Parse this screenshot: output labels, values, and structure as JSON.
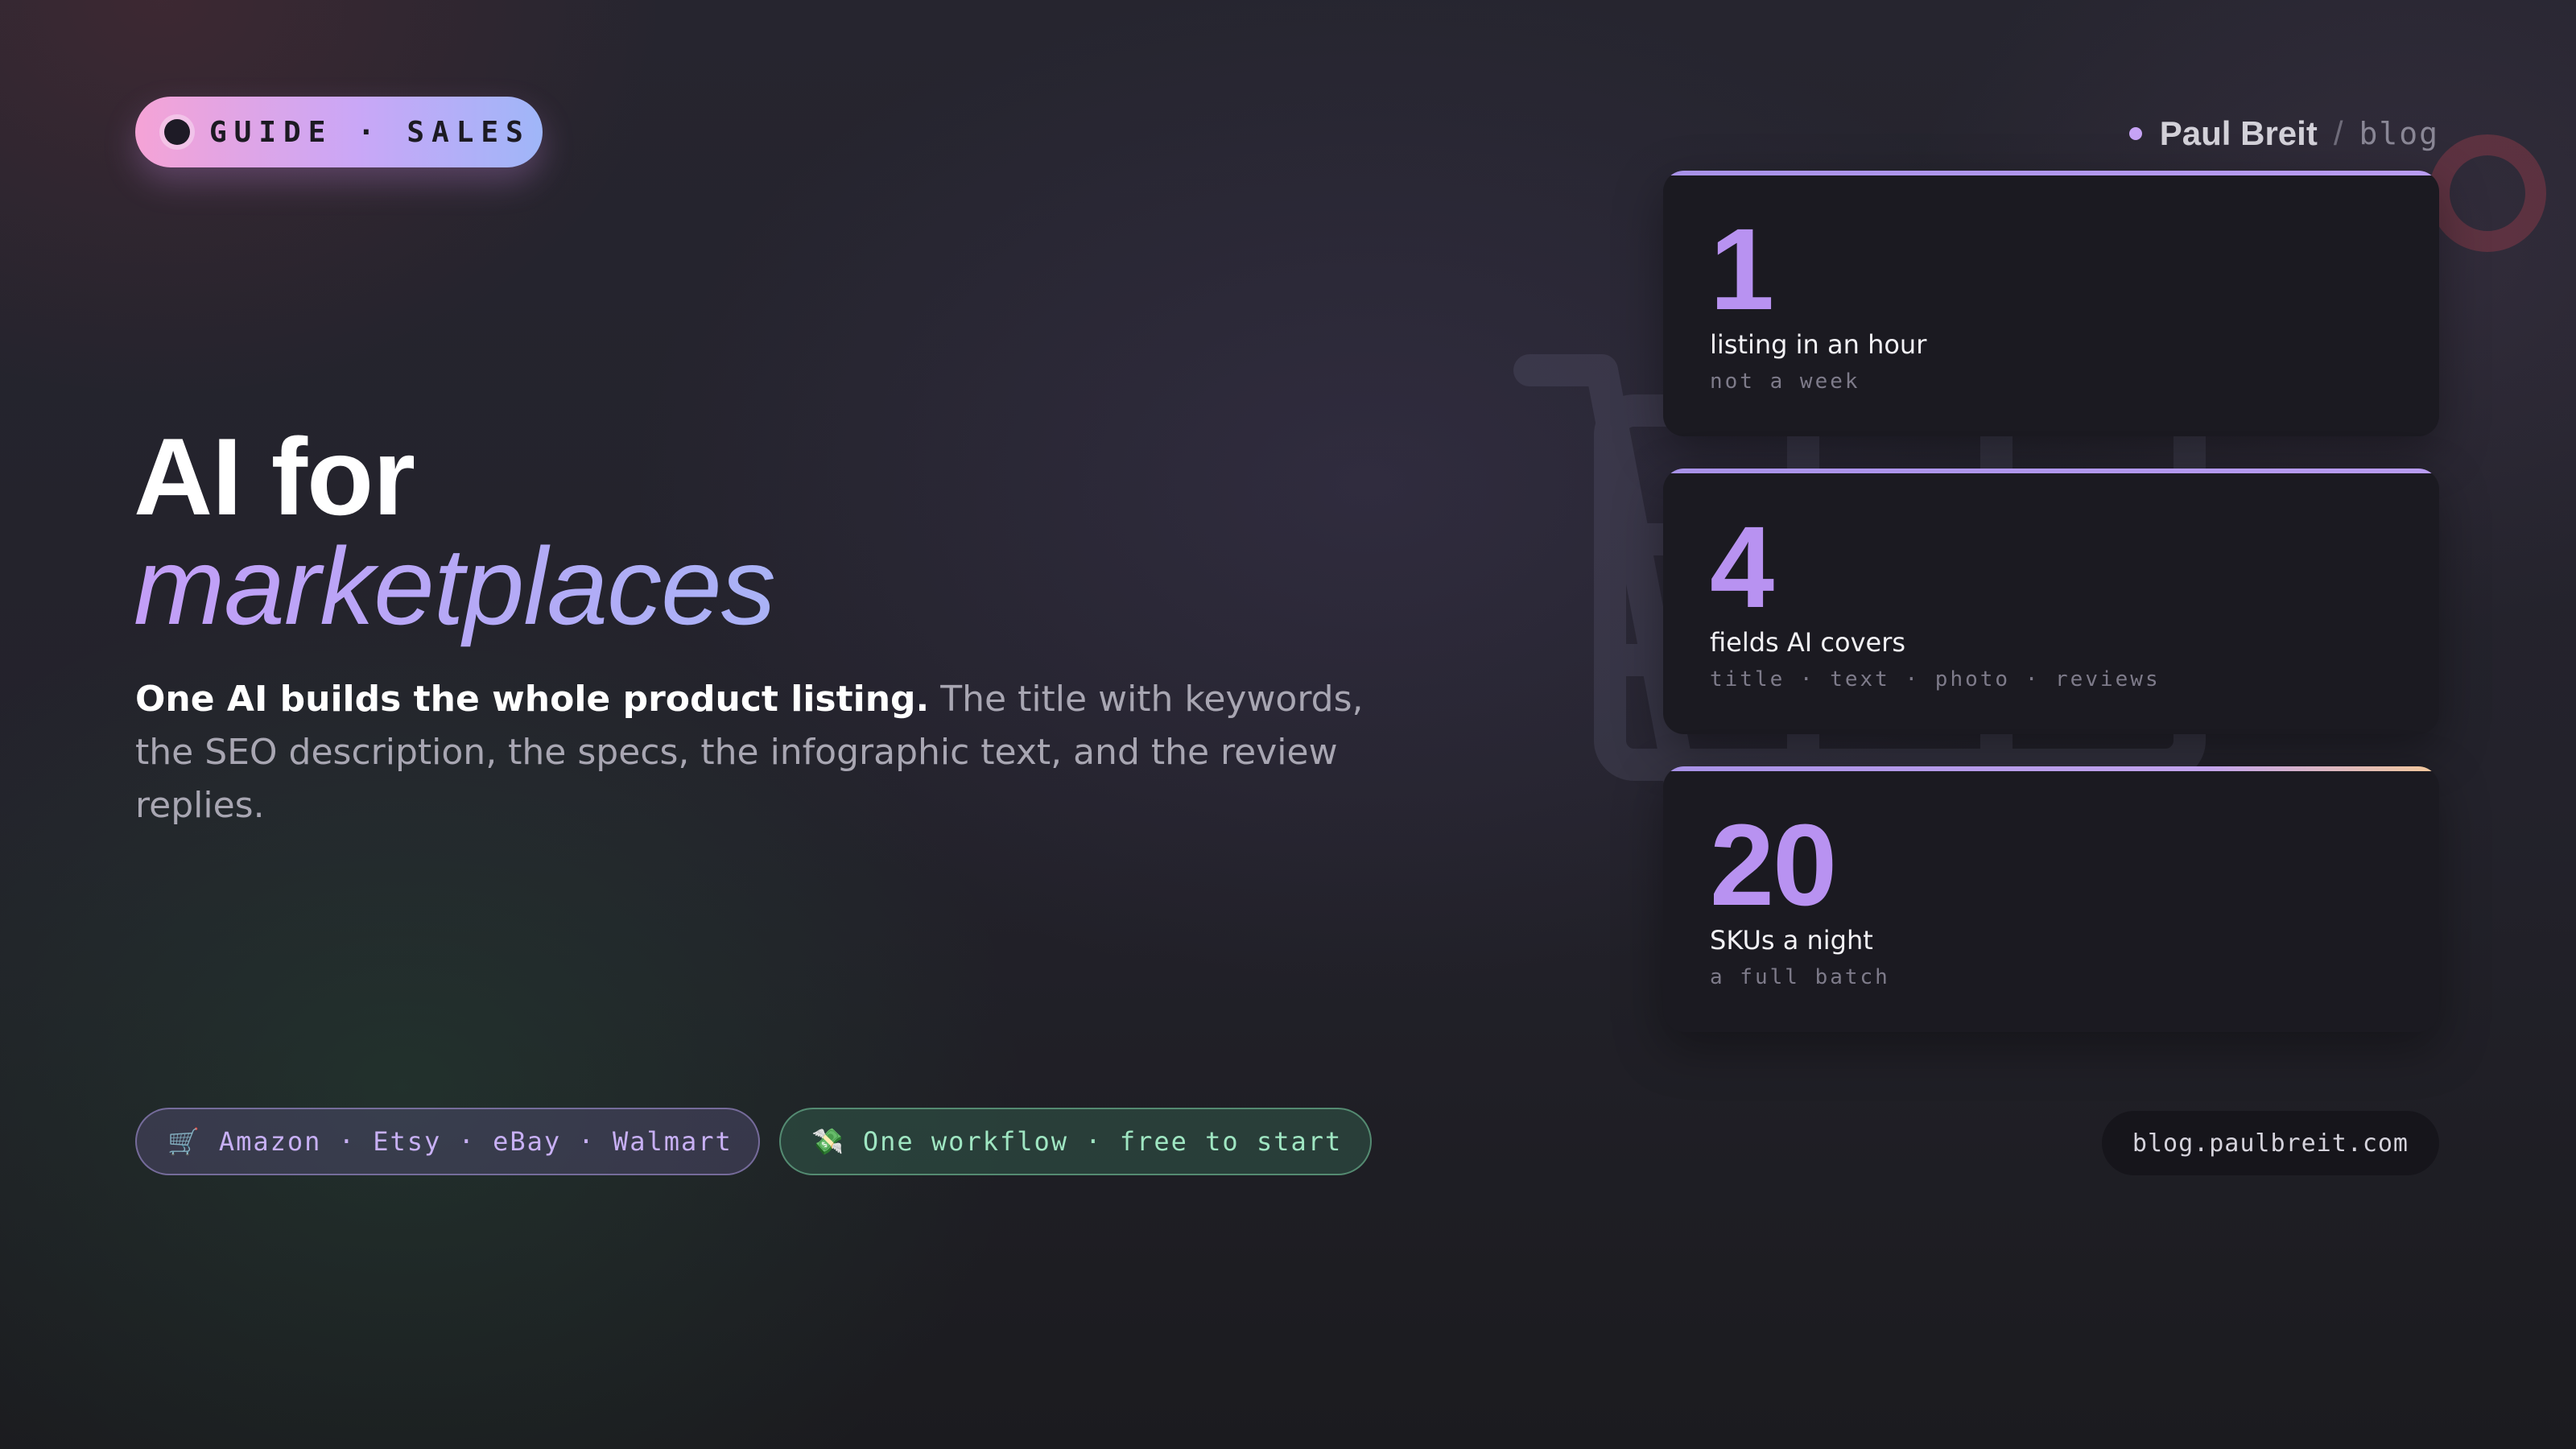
{
  "badge": {
    "text": "GUIDE · SALES"
  },
  "author": {
    "name": "Paul Breit",
    "separator": "/",
    "section": "blog"
  },
  "headline": {
    "line1": "AI for",
    "line2": "marketplaces"
  },
  "lede": {
    "bold": "One AI builds the whole product listing.",
    "rest": " The title with keywords, the SEO description, the specs, the infographic text, and the review replies."
  },
  "stats": [
    {
      "number": "1",
      "label": "listing in an hour",
      "sub": "not a week"
    },
    {
      "number": "4",
      "label": "fields AI covers",
      "sub": "title · text · photo · reviews"
    },
    {
      "number": "20",
      "label": "SKUs a night",
      "sub": "a full batch"
    }
  ],
  "tags": {
    "marketplaces": {
      "icon": "shopping-cart-icon",
      "glyph": "🛒",
      "text": "Amazon · Etsy · eBay · Walmart"
    },
    "workflow": {
      "icon": "money-with-wings-icon",
      "glyph": "💸",
      "text": "One workflow · free to start"
    }
  },
  "url": "blog.paulbreit.com",
  "colors": {
    "accent_purple": "#b892f1",
    "accent_blue": "#a9b2f6",
    "accent_pink": "#f5a3d6",
    "accent_green": "#9fe6c2",
    "card_bg": "#1b1a21"
  }
}
